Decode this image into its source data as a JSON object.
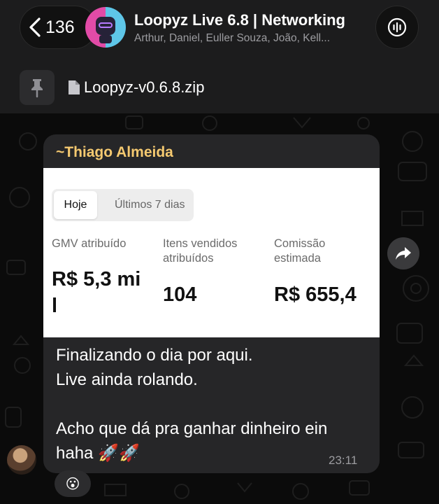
{
  "header": {
    "back_count": "136",
    "title": "Loopyz Live 6.8 | Networking",
    "members": "Arthur, Daniel, Euller Souza, João, Kell..."
  },
  "pinned": {
    "file_name": "Loopyz-v0.6.8.zip"
  },
  "message": {
    "sender": "~Thiago Almeida",
    "card": {
      "tabs": [
        "Hoje",
        "Últimos 7 dias"
      ],
      "active_tab": "Hoje",
      "metrics": [
        {
          "label": "GMV atribuído",
          "value": "R$ 5,3 mi\nl"
        },
        {
          "label": "Itens vendidos\natribuídos",
          "value": "104"
        },
        {
          "label": "Comissão\nestimada",
          "value": "R$ 655,4"
        }
      ]
    },
    "text_paragraph_1": "Finalizando o dia por aqui.\nLive ainda rolando.",
    "text_paragraph_2": "Acho que dá pra ganhar dinheiro ein\nhaha 🚀🚀",
    "time": "23:11",
    "reaction": "😮"
  }
}
